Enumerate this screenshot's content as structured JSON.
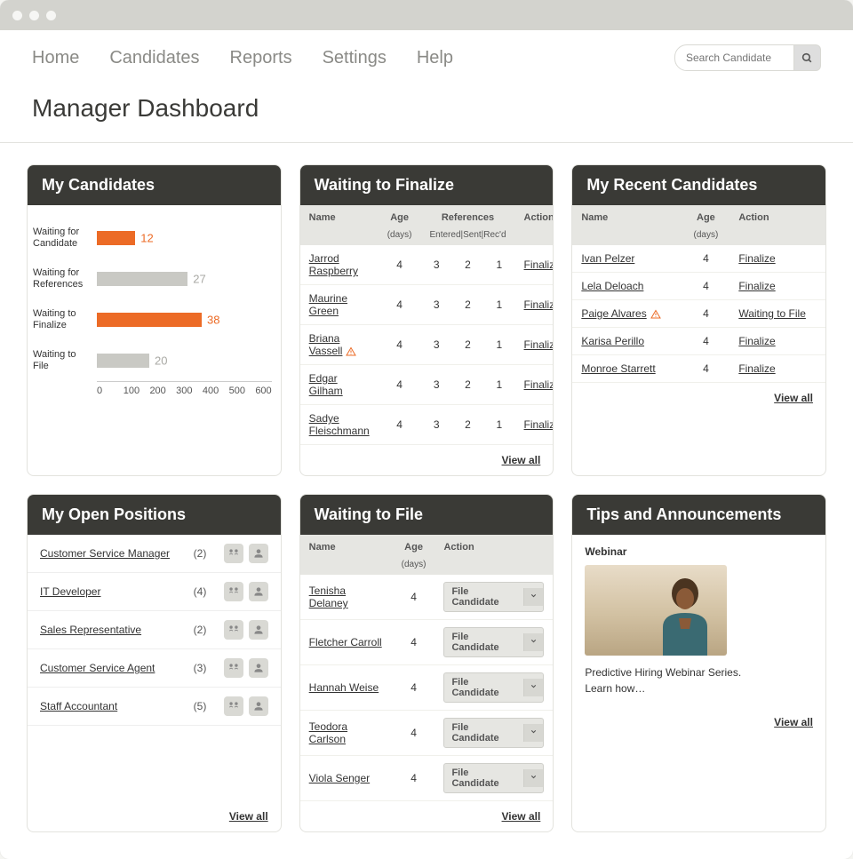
{
  "nav": {
    "items": [
      "Home",
      "Candidates",
      "Reports",
      "Settings",
      "Help"
    ]
  },
  "search": {
    "placeholder": "Search Candidate"
  },
  "page_title": "Manager Dashboard",
  "colors": {
    "accent": "#ec6b26",
    "muted_bar": "#c9c9c4"
  },
  "cards": {
    "my_candidates": {
      "title": "My Candidates"
    },
    "waiting_finalize": {
      "title": "Waiting to Finalize"
    },
    "recent_candidates": {
      "title": "My Recent Candidates"
    },
    "open_positions": {
      "title": "My Open Positions"
    },
    "waiting_file": {
      "title": "Waiting to File"
    },
    "tips": {
      "title": "Tips and Announcements"
    }
  },
  "chart_data": {
    "type": "bar",
    "orientation": "horizontal",
    "categories": [
      "Waiting for Candidate",
      "Waiting for References",
      "Waiting to Finalize",
      "Waiting to File"
    ],
    "values": [
      12,
      27,
      38,
      20
    ],
    "highlighted": [
      true,
      false,
      true,
      false
    ],
    "xlim": [
      0,
      600
    ],
    "xticks": [
      0,
      100,
      200,
      300,
      400,
      500,
      600
    ],
    "title": "",
    "xlabel": "",
    "ylabel": ""
  },
  "chart_display": {
    "rows": [
      {
        "label": "Waiting for Candidate",
        "value": "12",
        "width_pct": 22,
        "highlight": true
      },
      {
        "label": "Waiting for References",
        "value": "27",
        "width_pct": 52,
        "highlight": false
      },
      {
        "label": "Waiting to Finalize",
        "value": "38",
        "width_pct": 60,
        "highlight": true
      },
      {
        "label": "Waiting to File",
        "value": "20",
        "width_pct": 30,
        "highlight": false
      }
    ],
    "ticks": [
      "0",
      "100",
      "200",
      "300",
      "400",
      "500",
      "600"
    ]
  },
  "waiting_finalize": {
    "headers": {
      "name": "Name",
      "age": "Age",
      "age_sub": "(days)",
      "refs": "References",
      "refs_sub": "Entered|Sent|Rec'd",
      "action": "Action"
    },
    "rows": [
      {
        "name": "Jarrod Raspberry",
        "age": "4",
        "r1": "3",
        "r2": "2",
        "r3": "1",
        "action": "Finalize",
        "warn": false
      },
      {
        "name": "Maurine Green",
        "age": "4",
        "r1": "3",
        "r2": "2",
        "r3": "1",
        "action": "Finalize",
        "warn": false
      },
      {
        "name": "Briana Vassell",
        "age": "4",
        "r1": "3",
        "r2": "2",
        "r3": "1",
        "action": "Finalize",
        "warn": true
      },
      {
        "name": "Edgar Gilham",
        "age": "4",
        "r1": "3",
        "r2": "2",
        "r3": "1",
        "action": "Finalize",
        "warn": false
      },
      {
        "name": "Sadye Fleischmann",
        "age": "4",
        "r1": "3",
        "r2": "2",
        "r3": "1",
        "action": "Finalize",
        "warn": false
      }
    ],
    "view_all": "View all"
  },
  "recent_candidates": {
    "headers": {
      "name": "Name",
      "age": "Age",
      "age_sub": "(days)",
      "action": "Action"
    },
    "rows": [
      {
        "name": "Ivan Pelzer",
        "age": "4",
        "action": "Finalize",
        "warn": false
      },
      {
        "name": "Lela Deloach",
        "age": "4",
        "action": "Finalize",
        "warn": false
      },
      {
        "name": "Paige Alvares",
        "age": "4",
        "action": "Waiting to File",
        "warn": true
      },
      {
        "name": "Karisa Perillo",
        "age": "4",
        "action": "Finalize",
        "warn": false
      },
      {
        "name": "Monroe Starrett",
        "age": "4",
        "action": "Finalize",
        "warn": false
      }
    ],
    "view_all": "View all"
  },
  "open_positions": {
    "rows": [
      {
        "name": "Customer Service Manager",
        "count": "(2)"
      },
      {
        "name": "IT Developer",
        "count": "(4)"
      },
      {
        "name": "Sales Representative",
        "count": "(2)"
      },
      {
        "name": "Customer Service Agent",
        "count": "(3)"
      },
      {
        "name": "Staff Accountant",
        "count": "(5)"
      }
    ],
    "view_all": "View all"
  },
  "waiting_file": {
    "headers": {
      "name": "Name",
      "age": "Age",
      "age_sub": "(days)",
      "action": "Action"
    },
    "dd_label": "File Candidate",
    "rows": [
      {
        "name": "Tenisha Delaney",
        "age": "4"
      },
      {
        "name": "Fletcher Carroll",
        "age": "4"
      },
      {
        "name": "Hannah Weise",
        "age": "4"
      },
      {
        "name": "Teodora Carlson",
        "age": "4"
      },
      {
        "name": "Viola Senger",
        "age": "4"
      }
    ],
    "view_all": "View all"
  },
  "tips": {
    "subtitle": "Webinar",
    "text1": "Predictive Hiring Webinar Series.",
    "text2": "Learn how…",
    "view_all": "View all"
  }
}
